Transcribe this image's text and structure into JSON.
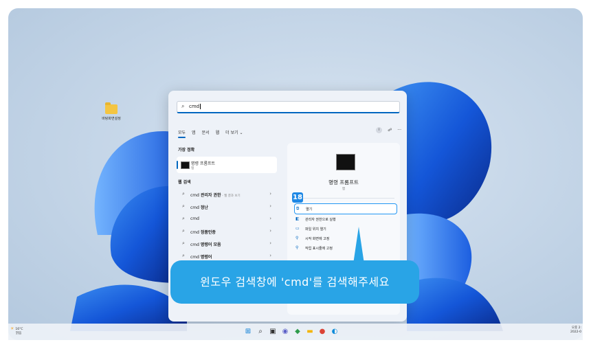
{
  "desktop": {
    "icon_label": "바탕화면설정"
  },
  "search": {
    "query": "cmd",
    "search_icon": "search-icon"
  },
  "filters": {
    "all": "모두",
    "apps": "앱",
    "documents": "문서",
    "web": "웹",
    "more": "더 보기 ⌄",
    "badge": "i",
    "more_options": "···"
  },
  "best_match": {
    "heading": "가장 정확",
    "title": "명령 프롬프트",
    "type": "앱"
  },
  "web_search": {
    "heading": "웹 검색",
    "items": [
      {
        "query": "cmd",
        "bold": "관리자 권한",
        "sub": " - 웹 결과 보기"
      },
      {
        "query": "cmd",
        "bold": "정난",
        "sub": ""
      },
      {
        "query": "cmd",
        "bold": "",
        "sub": ""
      },
      {
        "query": "cmd",
        "bold": "정품인증",
        "sub": ""
      },
      {
        "query": "cmd",
        "bold": "명령어 모음",
        "sub": ""
      },
      {
        "query": "cmd",
        "bold": "명령어",
        "sub": ""
      }
    ]
  },
  "detail": {
    "name": "명령 프롬프트",
    "type": "앱",
    "actions": [
      {
        "label": "열기",
        "icon": "open-icon"
      },
      {
        "label": "관리자 권한으로 실행",
        "icon": "shield-icon"
      },
      {
        "label": "파일 위치 열기",
        "icon": "folder-icon"
      },
      {
        "label": "시작 화면에 고정",
        "icon": "pin-icon"
      },
      {
        "label": "작업 표시줄에 고정",
        "icon": "pin-icon"
      }
    ]
  },
  "annotation": {
    "step": "18",
    "callout": "윈도우 검색창에 'cmd'를 검색해주세요"
  },
  "taskbar": {
    "temperature": "16°C",
    "weather": "맑음",
    "time": "오후 2:",
    "date": "2022-0"
  },
  "colors": {
    "accent": "#0067c0",
    "callout": "#29a4e6",
    "highlight": "#2196f3"
  }
}
